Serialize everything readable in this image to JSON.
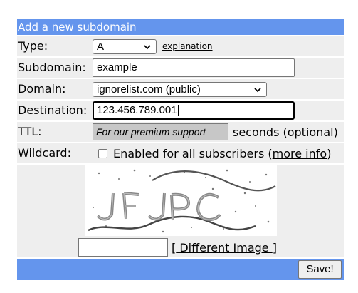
{
  "header": {
    "title": "Add a new subdomain"
  },
  "type": {
    "label": "Type:",
    "value": "A",
    "explanation": "explanation"
  },
  "subdomain": {
    "label": "Subdomain:",
    "value": "example"
  },
  "domain": {
    "label": "Domain:",
    "value": "ignorelist.com (public)"
  },
  "destination": {
    "label": "Destination:",
    "value": "123.456.789.001"
  },
  "ttl": {
    "label": "TTL:",
    "value": "For our premium support",
    "suffix": "seconds (optional)"
  },
  "wildcard": {
    "label": "Wildcard:",
    "checked": false,
    "text": "Enabled for all subscribers (",
    "more_info": "more info",
    "close": ")"
  },
  "captcha": {
    "bracket_open": "[",
    "different_image": " Different Image ",
    "bracket_close": "]",
    "input_value": ""
  },
  "footer": {
    "save_label": "Save!"
  },
  "colors": {
    "header_bg": "#6495ED",
    "row_bg": "#EEEEEE",
    "ttl_bg": "#C7C7C7"
  }
}
